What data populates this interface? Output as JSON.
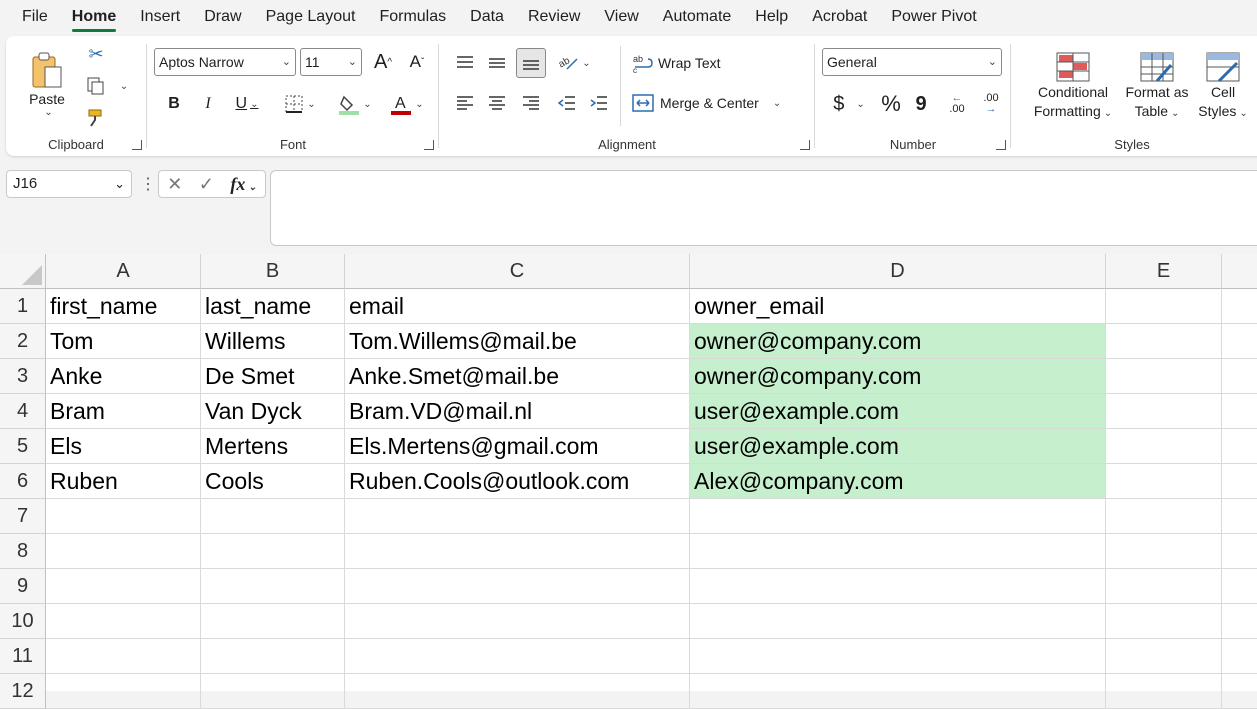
{
  "tabs": [
    "File",
    "Home",
    "Insert",
    "Draw",
    "Page Layout",
    "Formulas",
    "Data",
    "Review",
    "View",
    "Automate",
    "Help",
    "Acrobat",
    "Power Pivot"
  ],
  "active_tab": "Home",
  "ribbon": {
    "clipboard": {
      "label": "Clipboard",
      "paste": "Paste"
    },
    "font": {
      "label": "Font",
      "font_name": "Aptos Narrow",
      "font_size": "11",
      "bold": "B",
      "italic": "I",
      "underline": "U",
      "grow": "A",
      "shrink": "A"
    },
    "alignment": {
      "label": "Alignment",
      "wrap_text": "Wrap Text",
      "merge_center": "Merge & Center"
    },
    "number": {
      "label": "Number",
      "format": "General",
      "currency": "$",
      "percent": "%",
      "comma": "9",
      "inc_decimal": ".00",
      "dec_decimal": ".00"
    },
    "styles": {
      "label": "Styles",
      "conditional": [
        "Conditional",
        "Formatting"
      ],
      "format_table": [
        "Format as",
        "Table"
      ],
      "cell_styles": [
        "Cell",
        "Styles"
      ]
    }
  },
  "formula_bar": {
    "name_box": "J16",
    "fx": "fx",
    "value": ""
  },
  "colors": {
    "accent": "#0f7b3d",
    "highlight": "#c6efce"
  },
  "sheet": {
    "columns": [
      "A",
      "B",
      "C",
      "D",
      "E"
    ],
    "rows": [
      "1",
      "2",
      "3",
      "4",
      "5",
      "6",
      "7",
      "8",
      "9",
      "10",
      "11",
      "12"
    ],
    "cells": [
      [
        "first_name",
        "last_name",
        "email",
        "owner_email",
        ""
      ],
      [
        "Tom",
        "Willems",
        "Tom.Willems@mail.be",
        "owner@company.com",
        ""
      ],
      [
        "Anke",
        "De Smet",
        "Anke.Smet@mail.be",
        "owner@company.com",
        ""
      ],
      [
        "Bram",
        "Van Dyck",
        "Bram.VD@mail.nl",
        "user@example.com",
        ""
      ],
      [
        "Els",
        "Mertens",
        "Els.Mertens@gmail.com",
        "user@example.com",
        ""
      ],
      [
        "Ruben",
        "Cools",
        "Ruben.Cools@outlook.com",
        "Alex@company.com",
        ""
      ]
    ]
  }
}
